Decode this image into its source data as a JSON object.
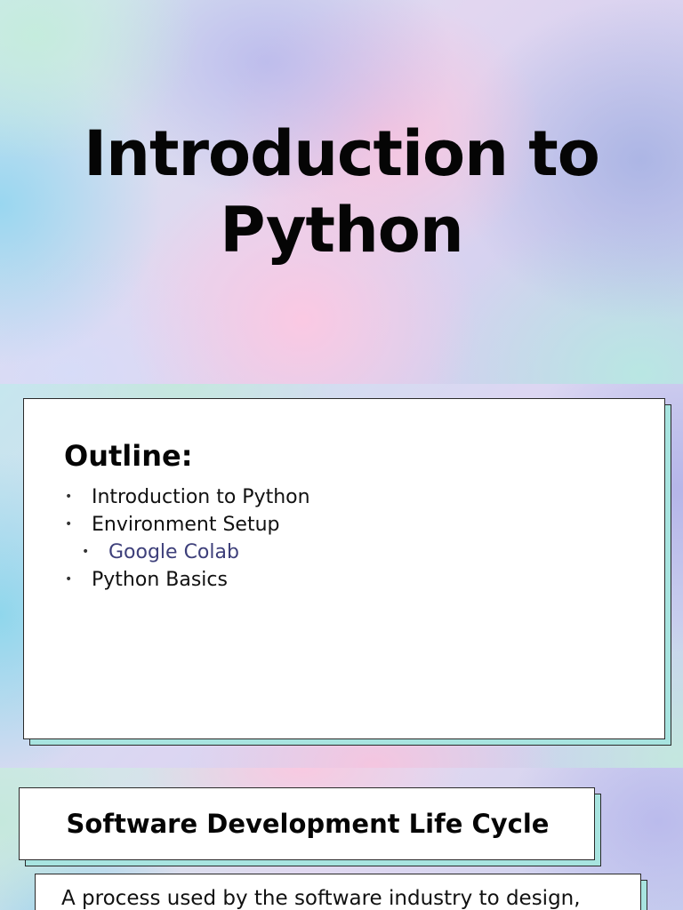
{
  "slide1": {
    "title_line1": "Introduction to",
    "title_line2": "Python"
  },
  "slide2": {
    "heading": "Outline:",
    "bullet_glyph": "•",
    "items": [
      {
        "label": "Introduction to Python",
        "level": 0
      },
      {
        "label": "Environment Setup",
        "level": 0
      },
      {
        "label": "Google Colab",
        "level": 1
      },
      {
        "label": "Python Basics",
        "level": 0
      }
    ]
  },
  "slide3": {
    "heading": "Software Development Life Cycle",
    "description": "A process used by the software industry to design,"
  },
  "colors": {
    "card_shadow": "#a8e4e0",
    "sub_item_text": "#3d3f7a",
    "border": "#2a2a2a"
  }
}
